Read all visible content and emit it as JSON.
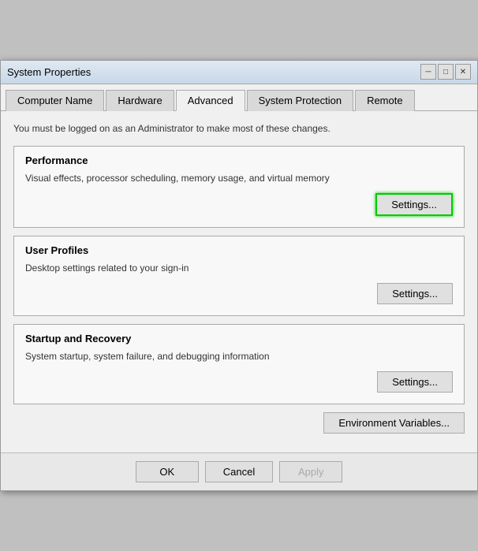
{
  "window": {
    "title": "System Properties",
    "close_label": "✕",
    "minimize_label": "─",
    "maximize_label": "□"
  },
  "tabs": [
    {
      "label": "Computer Name",
      "active": false
    },
    {
      "label": "Hardware",
      "active": false
    },
    {
      "label": "Advanced",
      "active": true
    },
    {
      "label": "System Protection",
      "active": false
    },
    {
      "label": "Remote",
      "active": false
    }
  ],
  "admin_notice": "You must be logged on as an Administrator to make most of these changes.",
  "sections": {
    "performance": {
      "title": "Performance",
      "desc": "Visual effects, processor scheduling, memory usage, and virtual memory",
      "settings_label": "Settings...",
      "highlighted": true
    },
    "user_profiles": {
      "title": "User Profiles",
      "desc": "Desktop settings related to your sign-in",
      "settings_label": "Settings..."
    },
    "startup_recovery": {
      "title": "Startup and Recovery",
      "desc": "System startup, system failure, and debugging information",
      "settings_label": "Settings..."
    }
  },
  "env_variables": {
    "btn_label": "Environment Variables..."
  },
  "footer": {
    "ok_label": "OK",
    "cancel_label": "Cancel",
    "apply_label": "Apply"
  }
}
